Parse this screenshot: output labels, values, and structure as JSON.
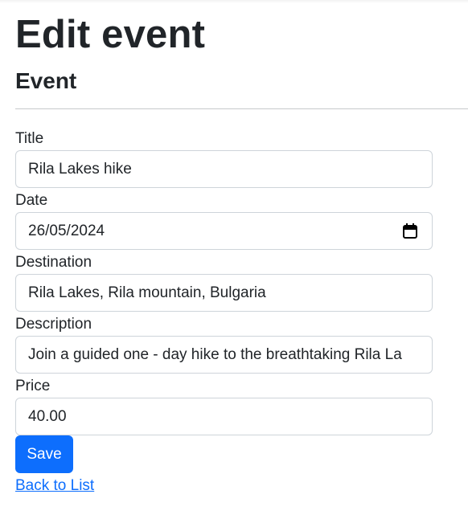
{
  "page": {
    "title": "Edit event",
    "section_title": "Event"
  },
  "form": {
    "title": {
      "label": "Title",
      "value": "Rila Lakes hike"
    },
    "date": {
      "label": "Date",
      "value": "26/05/2024",
      "icon": "calendar-icon"
    },
    "destination": {
      "label": "Destination",
      "value": "Rila Lakes, Rila mountain, Bulgaria"
    },
    "description": {
      "label": "Description",
      "value": "Join a guided one - day hike to the breathtaking Rila La"
    },
    "price": {
      "label": "Price",
      "value": "40.00"
    },
    "save_label": "Save"
  },
  "links": {
    "back_label": "Back to List"
  },
  "colors": {
    "primary": "#0d6efd",
    "text": "#212529",
    "input_border": "#ced4da"
  }
}
